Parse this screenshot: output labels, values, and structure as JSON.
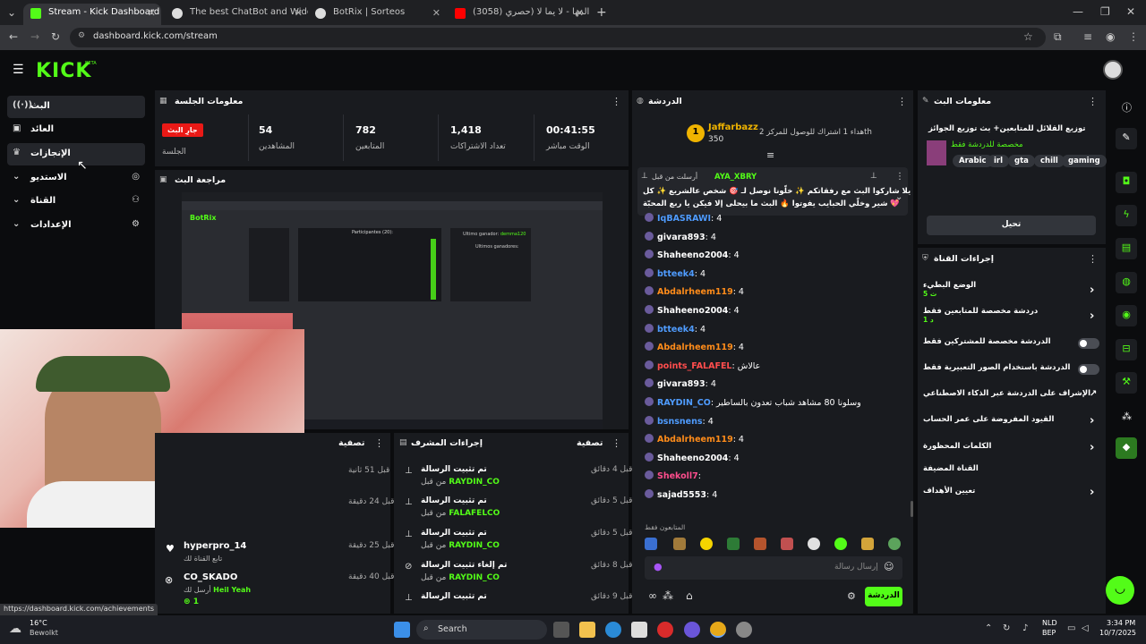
{
  "browser": {
    "tabs": [
      {
        "title": "Stream - Kick Dashboard",
        "color": "#53fc18"
      },
      {
        "title": "The best ChatBot and Widgets",
        "color": "#cccccc"
      },
      {
        "title": "BotRix | Sorteos",
        "color": "#cccccc"
      },
      {
        "title": "(3058) المها - لا يما لا (حصري",
        "color": "#ff0000"
      }
    ],
    "url": "dashboard.kick.com/stream",
    "status_url": "https://dashboard.kick.com/achievements"
  },
  "app": {
    "logo": "KICK",
    "logo_badge": "BETA",
    "accent": "#53fc18"
  },
  "sidebar": {
    "items": [
      {
        "label": "البث",
        "icon": "live-icon"
      },
      {
        "label": "العائد",
        "icon": "wallet-icon"
      },
      {
        "label": "الإنجازات",
        "icon": "trophy-icon"
      },
      {
        "label": "الاستديو",
        "icon": "studio-icon"
      },
      {
        "label": "القناة",
        "icon": "channel-icon"
      },
      {
        "label": "الإعدادات",
        "icon": "settings-icon"
      }
    ]
  },
  "session": {
    "title": "معلومات الجلسة",
    "badge": "جارِ البث",
    "badge_label": "الجلسة",
    "stats": [
      {
        "value": "54",
        "label": "المشاهدين"
      },
      {
        "value": "782",
        "label": "المتابعين"
      },
      {
        "value": "1,418",
        "label": "تعداد الاشتراكات"
      },
      {
        "value": "00:41:55",
        "label": "الوقت مباشر"
      }
    ]
  },
  "preview": {
    "title": "مراجعة البث",
    "botrix_title": "BotRix",
    "participants": "Participantes (20):",
    "last_winner_label": "Ultimo ganador:",
    "last_winner": "demma120",
    "winners_label": "Ultimos ganadores:"
  },
  "activity": {
    "title": "تصفية",
    "items": [
      {
        "time": "قبل 51 ثانية"
      },
      {
        "time": "قبل 24 دقيقة"
      },
      {
        "time": "قبل 25 دقيقة",
        "user": "hyperpro_14",
        "text": "تابع القناة لك"
      },
      {
        "time": "قبل 40 دقيقة",
        "user": "CO_SKADO",
        "text": "أرسل لك",
        "extra": "Heil Yeah",
        "count": "1"
      }
    ]
  },
  "modactions": {
    "title": "إجراءات المشرف",
    "filter": "تصفية",
    "items": [
      {
        "action": "تم تثبيت الرسالة",
        "by": "من قبل",
        "user": "RAYDIN_CO",
        "time": "قبل 4 دقائق"
      },
      {
        "action": "تم تثبيت الرسالة",
        "by": "من قبل",
        "user": "FALAFELCO",
        "time": "قبل 5 دقائق"
      },
      {
        "action": "تم تثبيت الرسالة",
        "by": "من قبل",
        "user": "RAYDIN_CO",
        "time": "قبل 5 دقائق"
      },
      {
        "action": "تم إلغاء تثبيت الرسالة",
        "by": "من قبل",
        "user": "RAYDIN_CO",
        "time": "قبل 8 دقائق"
      },
      {
        "action": "تم تثبيت الرسالة",
        "by": "من قبل",
        "user": "RAYDIN_CO",
        "time": "قبل 9 دقائق"
      }
    ]
  },
  "chat": {
    "title": "الدردشة",
    "goal_user": "Jaffarbazz",
    "goal_amount": "350",
    "goal_rank": "1",
    "goal_text": "هداء 1 اشتراك للوصول للمركز 2th",
    "pinned_by": "أرسلت من قبل",
    "pinned_user": "AYA_XBRY",
    "pinned_line1": "يلا شاركوا البث مع رفقاتكم ✨ خلّونا نوصل لـ 🎯 شخص عالشريع ✨ كل",
    "pinned_line2": "شير وخلّي الحبايب يفوتوا 🔥 البث ما بيحلى إلا فيكن يا ربع المحبّة 💖",
    "messages": [
      {
        "user": "IqBASRAWI",
        "text": "4",
        "color": "#4f9cff"
      },
      {
        "user": "givara893",
        "text": "4",
        "color": "#ffffff"
      },
      {
        "user": "Shaheeno2004",
        "text": "4",
        "color": "#ffffff"
      },
      {
        "user": "btteek4",
        "text": "4",
        "color": "#4f9cff"
      },
      {
        "user": "Abdalrheem119",
        "text": "4",
        "color": "#ff8c1a"
      },
      {
        "user": "Shaheeno2004",
        "text": "4",
        "color": "#ffffff"
      },
      {
        "user": "btteek4",
        "text": "4",
        "color": "#4f9cff"
      },
      {
        "user": "Abdalrheem119",
        "text": "4",
        "color": "#ff8c1a"
      },
      {
        "user": "points_FALAFEL",
        "text": "عالاش",
        "color": "#ff4d4d"
      },
      {
        "user": "givara893",
        "text": "4",
        "color": "#ffffff"
      },
      {
        "user": "RAYDIN_CO",
        "text": "وسلونا 80 مشاهد شباب تعدون بالساطير",
        "color": "#4f9cff"
      },
      {
        "user": "bsnsnens",
        "text": "4",
        "color": "#4f9cff"
      },
      {
        "user": "Abdalrheem119",
        "text": "4",
        "color": "#ff8c1a"
      },
      {
        "user": "Shaheeno2004",
        "text": "4",
        "color": "#ffffff"
      },
      {
        "user": "Shekoll7",
        "text": "",
        "color": "#ff4d8d"
      },
      {
        "user": "sajad5553",
        "text": "4",
        "color": "#ffffff"
      }
    ],
    "followers_only": "المتابعون فقط",
    "input_placeholder": "إرسال رسالة",
    "send_label": "الدردشة"
  },
  "stream_info": {
    "title": "معلومات البث",
    "stream_title": "توزيع القلائل للمتابعين+ بث توزيع الجوائز",
    "category": "مخصصة للدردشة فقط",
    "tags": [
      "Arabic",
      "irl",
      "gta",
      "chill",
      "gaming"
    ],
    "edit_label": "تحيل"
  },
  "channel_actions": {
    "title": "إجراءات القناة",
    "rows": [
      {
        "label": "الوضع البطيء",
        "sub": "5 ث",
        "control": "chevron"
      },
      {
        "label": "دردشة مخصصة للمتابعين فقط",
        "sub": "1 د",
        "control": "chevron"
      },
      {
        "label": "الدردشة مخصصة للمشتركين فقط",
        "control": "toggle"
      },
      {
        "label": "الدردشة باستخدام الصور التعبيرية فقط",
        "control": "toggle"
      },
      {
        "label": "الإشراف على الدردشة عبر الذكاء الاصطناعي",
        "control": "external"
      },
      {
        "label": "القيود المفروضة على عمر الحساب",
        "control": "chevron"
      },
      {
        "label": "الكلمات المحظورة",
        "control": "chevron"
      },
      {
        "label": "القناة المضيفة",
        "control": "none"
      },
      {
        "label": "تعيين الأهداف",
        "control": "chevron"
      }
    ]
  },
  "taskbar": {
    "weather_temp": "16°C",
    "weather_text": "Bewolkt",
    "search": "Search",
    "lang": "NLD",
    "lang2": "BEP",
    "time": "3:34 PM",
    "date": "10/7/2025"
  }
}
